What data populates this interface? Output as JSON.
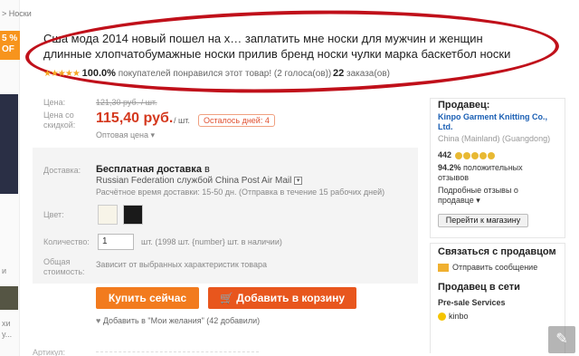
{
  "breadcrumb": "> Носки",
  "discount": "5 % OF",
  "side_text": {
    "a": "и",
    "b": "хи",
    "c": "у..."
  },
  "title": "Сша мода 2014 новый пошел на х… заплатить мне носки для мужчин и женщин длинные хлопчатобумажные носки прилив бренд носки чулки марка баскетбол носки",
  "rating": {
    "stars": "★★★★★",
    "percent": "100.0%",
    "text": "покупателей понравился этот товар! (2 голоса(ов))",
    "orders_count": "22",
    "orders_label": "заказа(ов)"
  },
  "price": {
    "label_price": "Цена:",
    "old": "121,30 руб. / шт.",
    "label_discount": "Цена со скидкой:",
    "new": "115,40 руб.",
    "unit": "/ шт.",
    "days_left": "Осталось дней: 4",
    "wholesale": "Оптовая цена ▾"
  },
  "shipping": {
    "label": "Доставка:",
    "free": "Бесплатная доставка",
    "to": "в",
    "line2": "Russian Federation службой China Post Air Mail",
    "line3": "Расчётное время доставки: 15-50 дн. (Отправка в течение 15 рабочих дней)"
  },
  "color": {
    "label": "Цвет:"
  },
  "quantity": {
    "label": "Количество:",
    "value": "1",
    "note": "шт. (1998 шт. {number} шт. в наличии)"
  },
  "total": {
    "label": "Общая стоимость:",
    "note": "Зависит от выбранных характеристик товара"
  },
  "buttons": {
    "buy": "Купить сейчас",
    "cart": "Добавить в корзину",
    "wishlist": "Добавить в \"Мои желания\" (42 добавили)"
  },
  "bottom_label": "Артикул:",
  "seller": {
    "heading": "Продавец:",
    "name": "Kinpo Garment Knitting Co., Ltd.",
    "location": "China (Mainland) (Guangdong)",
    "score": "442",
    "positive": "94.2%",
    "positive_label": "положительных отзывов",
    "similar": "Подробные отзывы о продавце ▾",
    "store_button": "Перейти к магазину"
  },
  "contact": {
    "heading": "Связаться с продавцом",
    "message": "Отправить сообщение",
    "online_heading": "Продавец в сети",
    "presale": "Pre-sale Services",
    "agent": "kinbo"
  },
  "colors": {
    "accent_orange": "#f27b1e",
    "price_red": "#d4381e",
    "annotation_red": "#c0101a",
    "link_blue": "#1a5fb4"
  }
}
